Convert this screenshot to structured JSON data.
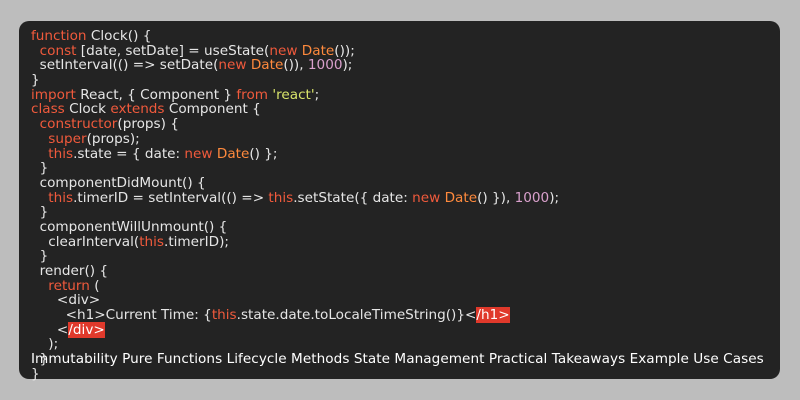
{
  "code_lines": [
    [
      {
        "t": "function",
        "c": "kw"
      },
      {
        "t": " Clock() {"
      }
    ],
    [
      {
        "t": "  "
      },
      {
        "t": "const",
        "c": "kw"
      },
      {
        "t": " [date, setDate] = useState("
      },
      {
        "t": "new",
        "c": "kw"
      },
      {
        "t": " "
      },
      {
        "t": "Date",
        "c": "fn"
      },
      {
        "t": "());"
      }
    ],
    [
      {
        "t": "  setInterval(() => setDate("
      },
      {
        "t": "new",
        "c": "kw"
      },
      {
        "t": " "
      },
      {
        "t": "Date",
        "c": "fn"
      },
      {
        "t": "()), "
      },
      {
        "t": "1000",
        "c": "num"
      },
      {
        "t": ");"
      }
    ],
    [
      {
        "t": "}"
      }
    ],
    [
      {
        "t": "import",
        "c": "kw"
      },
      {
        "t": " React, { Component } "
      },
      {
        "t": "from",
        "c": "kw"
      },
      {
        "t": " "
      },
      {
        "t": "'react'",
        "c": "str"
      },
      {
        "t": ";"
      }
    ],
    [
      {
        "t": "class",
        "c": "kw"
      },
      {
        "t": " Clock "
      },
      {
        "t": "extends",
        "c": "kw"
      },
      {
        "t": " Component {"
      }
    ],
    [
      {
        "t": "  "
      },
      {
        "t": "constructor",
        "c": "kw"
      },
      {
        "t": "(props) {"
      }
    ],
    [
      {
        "t": "    "
      },
      {
        "t": "super",
        "c": "kw"
      },
      {
        "t": "(props);"
      }
    ],
    [
      {
        "t": "    "
      },
      {
        "t": "this",
        "c": "kw"
      },
      {
        "t": ".state = { date: "
      },
      {
        "t": "new",
        "c": "kw"
      },
      {
        "t": " "
      },
      {
        "t": "Date",
        "c": "fn"
      },
      {
        "t": "() };"
      }
    ],
    [
      {
        "t": "  }"
      }
    ],
    [
      {
        "t": "  componentDidMount() {"
      }
    ],
    [
      {
        "t": "    "
      },
      {
        "t": "this",
        "c": "kw"
      },
      {
        "t": ".timerID = setInterval(() => "
      },
      {
        "t": "this",
        "c": "kw"
      },
      {
        "t": ".setState({ date: "
      },
      {
        "t": "new",
        "c": "kw"
      },
      {
        "t": " "
      },
      {
        "t": "Date",
        "c": "fn"
      },
      {
        "t": "() }), "
      },
      {
        "t": "1000",
        "c": "num"
      },
      {
        "t": ");"
      }
    ],
    [
      {
        "t": "  }"
      }
    ],
    [
      {
        "t": "  componentWillUnmount() {"
      }
    ],
    [
      {
        "t": "    clearInterval("
      },
      {
        "t": "this",
        "c": "kw"
      },
      {
        "t": ".timerID);"
      }
    ],
    [
      {
        "t": "  }"
      }
    ],
    [
      {
        "t": "  render() {"
      }
    ],
    [
      {
        "t": "    "
      },
      {
        "t": "return",
        "c": "kw"
      },
      {
        "t": " ("
      }
    ],
    [
      {
        "t": "      <div>"
      }
    ],
    [
      {
        "t": "        <h1>Current Time: {"
      },
      {
        "t": "this",
        "c": "kw"
      },
      {
        "t": ".state.date.toLocaleTimeString()}<"
      },
      {
        "t": "/h1>",
        "c": "tag"
      }
    ],
    [
      {
        "t": "      <"
      },
      {
        "t": "/div>",
        "c": "tag"
      }
    ],
    [
      {
        "t": "    );"
      }
    ],
    [
      {
        "t": "  }"
      }
    ],
    [
      {
        "t": "}"
      }
    ]
  ],
  "footer_text": "Immutability Pure Functions Lifecycle Methods State Management Practical Takeaways Example Use Cases",
  "colors": {
    "background": "#bdbdbd",
    "panel": "#232323",
    "keyword": "#f05a3c",
    "function_name": "#ff8a3d",
    "number": "#d9a0cc",
    "string": "#d8e46a",
    "tag_highlight": "#e0392b"
  }
}
